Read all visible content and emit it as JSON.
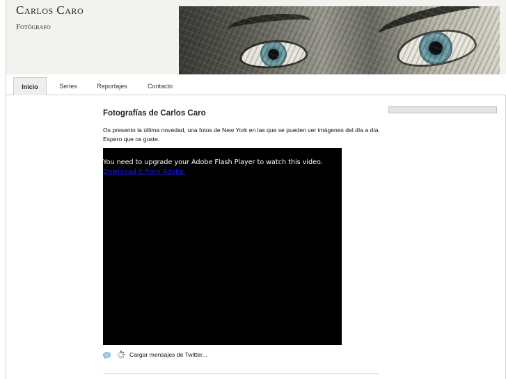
{
  "site": {
    "title": "Carlos Caro",
    "subtitle": "Fotógrafo"
  },
  "nav": {
    "tabs": [
      {
        "label": "Inicio",
        "active": true
      },
      {
        "label": "Series",
        "active": false
      },
      {
        "label": "Reportajes",
        "active": false
      },
      {
        "label": "Contacto",
        "active": false
      }
    ]
  },
  "post": {
    "title": "Fotografías de Carlos Caro",
    "body": "Os presento la última novedad, una fotos de New York en las que se pueden ver imágenes del día a día. Espero que os guste."
  },
  "video": {
    "message": "You need to upgrade your Adobe Flash Player to watch this video.",
    "link_text": "Download it from Adobe."
  },
  "twitter": {
    "loading_text": "Cargar mensajes de Twitter..."
  },
  "icons": {
    "bubble": "speech-bubble-icon",
    "spinner": "loading-spinner-icon"
  },
  "colors": {
    "header_bg": "#f2f2ef",
    "active_tab_bg": "#eeeeee",
    "video_bg": "#000000",
    "link": "#1a1aee"
  }
}
